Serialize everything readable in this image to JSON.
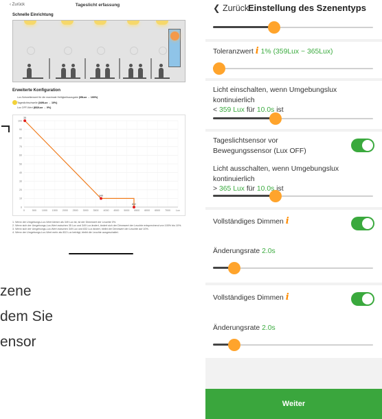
{
  "tablet": {
    "nav": {
      "back_label": "Zurück",
      "title": "Tageslicht erfassung"
    },
    "section1_title": "Schnelle Einrichtung",
    "section2_title": "Erweiterte Konfiguration",
    "cfg_line1": "Lux-Schwellenwert für die maximale Helligkeitsausgabe",
    "cfg_line1_value": "(35Lux → 100%)",
    "cfg_line2": "Tageslichtschwelle",
    "cfg_line2_value": "(349Lux → 10%)",
    "cfg_line3": "Lux OFF-Wert",
    "cfg_line3_value": "(832Lux → 0%)",
    "notes": [
      "1. Wenn der Umgebungs-Lux-Wert kleiner als 349 Lux ist, ist der Dimmwert der Leuchte 0%.",
      "2. Wenn sich der Umgebungs-Lux-Wert zwischen 35 Lux und 349 Lux ändert, ändert sich der Dimmwert der Leuchte entsprechend von 100% bis 10%.",
      "3. Wenn sich der Umgebungs-Lux-Wert zwischen 349 Lux und 832 Lux ändert, bleibt der Dimmwert der Leuchte auf 10%.",
      "4. Wenn der Umgebungs-Lux-Wert mehr als 832 Lux beträgt, bleibt die Leuchte ausgeschaltet."
    ]
  },
  "chart_data": {
    "type": "line",
    "title": "",
    "x_ticks": [
      "0",
      "500",
      "1000",
      "1500",
      "2000",
      "2500",
      "3000",
      "3500",
      "4000",
      "4500",
      "5000",
      "5500",
      "6000",
      "6500",
      "7000",
      "Lux"
    ],
    "y_ticks": [
      "0",
      "10",
      "20",
      "30",
      "40",
      "50",
      "60",
      "70",
      "80",
      "90",
      "100"
    ],
    "xlim": [
      0,
      7000
    ],
    "ylim": [
      0,
      100
    ],
    "series": [
      {
        "x": [
          35,
          3500,
          5000,
          5000
        ],
        "y": [
          100,
          10,
          10,
          0
        ],
        "color": "#f07b1c"
      }
    ],
    "points": [
      {
        "x": 35,
        "y": 100,
        "color": "#e02020",
        "label": "35"
      },
      {
        "x": 3500,
        "y": 10,
        "color": "#e02020",
        "label": "349"
      },
      {
        "x": 5000,
        "y": 0,
        "color": "#e02020",
        "label": "832"
      }
    ],
    "grid": true
  },
  "caption": {
    "line1": "zene",
    "line2": "dem Sie",
    "line3": "ensor"
  },
  "phone": {
    "nav": {
      "back_label": "Zurück",
      "title": "Einstellung des Szenentyps"
    },
    "slider0": 0.37,
    "toleranz": {
      "label": "Toleranzwert",
      "value": "1%",
      "range": "(359Lux ~ 365Lux)",
      "slider": 0.0
    },
    "licht_ein": {
      "prefix": "Licht einschalten, wenn Umgebungslux kontinuierlich",
      "line2_prefix": "<",
      "lux": "359 Lux",
      "fuer": "für",
      "time": "10.0s",
      "suffix": "ist",
      "slider": 0.38
    },
    "sensor": {
      "label": "Tageslichtsensor vor Bewegungssensor (Lux OFF)",
      "on": true
    },
    "licht_aus": {
      "prefix": "Licht ausschalten, wenn Umgebungslux kontinuierlich",
      "line2_prefix": ">",
      "lux": "365 Lux",
      "fuer": "für",
      "time": "10.0s",
      "suffix": "ist",
      "slider": 0.38
    },
    "dimmen1": {
      "label": "Vollständiges Dimmen",
      "on": true
    },
    "rate1": {
      "label": "Änderungsrate",
      "value": "2.0s",
      "slider": 0.1
    },
    "dimmen2": {
      "label": "Vollständiges Dimmen",
      "on": true
    },
    "rate2": {
      "label": "Änderungsrate",
      "value": "2.0s",
      "slider": 0.1
    },
    "info_glyph": "i",
    "weiter_label": "Weiter"
  }
}
